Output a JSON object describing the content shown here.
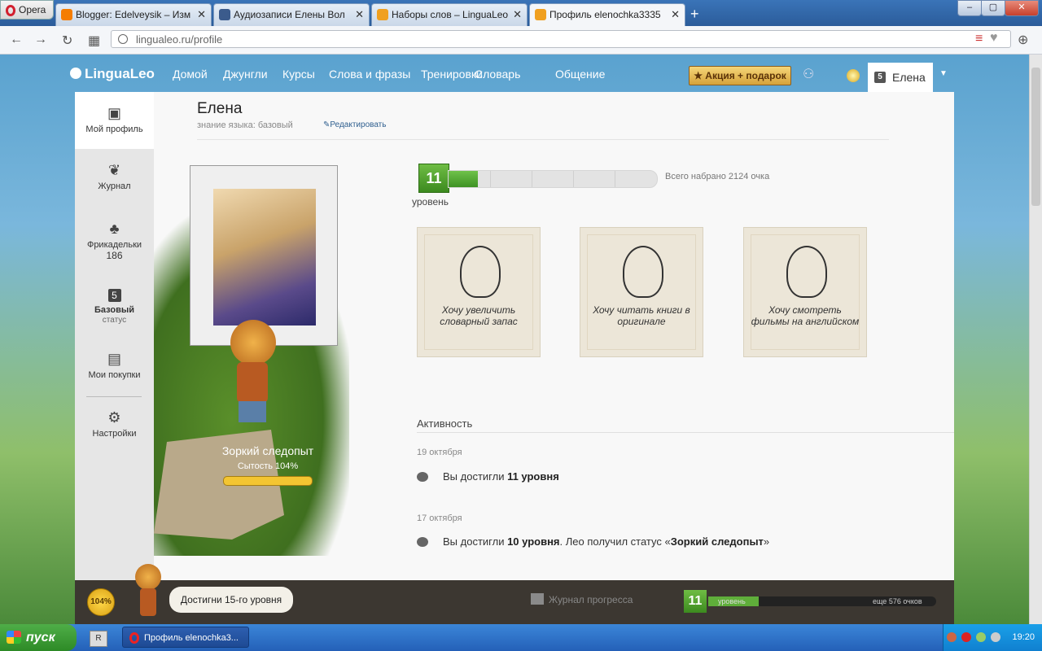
{
  "browser": {
    "opera_label": "Opera",
    "tabs": [
      {
        "title": "Blogger: Edelveysik – Изм",
        "active": false,
        "icon_color": "#f57d00"
      },
      {
        "title": "Аудиозаписи Елены Вол",
        "active": false,
        "icon_color": "#3b5b8c"
      },
      {
        "title": "Наборы слов – LinguaLeo",
        "active": false,
        "icon_color": "#f0a020"
      },
      {
        "title": "Профиль elenochka3335",
        "active": true,
        "icon_color": "#f0a020"
      }
    ],
    "newtab_glyph": "+",
    "url": "lingualeo.ru/profile"
  },
  "site": {
    "logo": "LinguaLeo",
    "menu": [
      "Домой",
      "Джунгли",
      "Курсы",
      "Слова и фразы",
      "Тренировки",
      "Словарь",
      "Общение"
    ],
    "promo": "★ Акция + подарок",
    "user_name": "Елена",
    "user_badge": "5"
  },
  "sidebar": {
    "items": [
      {
        "label": "Мой профиль",
        "icon": "profile-icon"
      },
      {
        "label": "Журнал",
        "icon": "leaf-icon"
      },
      {
        "label": "Фрикадельки",
        "count": "186",
        "icon": "meatballs-icon"
      },
      {
        "label": "Базовый",
        "sublabel": "статус",
        "icon": "status-badge-icon",
        "badge": "5"
      },
      {
        "label": "Мои покупки",
        "icon": "bag-icon"
      },
      {
        "label": "Настройки",
        "icon": "gear-icon"
      }
    ]
  },
  "profile": {
    "name": "Елена",
    "knowledge": "знание языка: базовый",
    "edit": "Редактировать",
    "leo_status": "Зоркий следопыт",
    "satiety": "Сытость 104%"
  },
  "level": {
    "value": "11",
    "label": "уровень",
    "progress_fraction": 0.14,
    "total": "Всего набрано 2124 очка"
  },
  "goals": [
    "Хочу увеличить словарный запас",
    "Хочу читать книги в оригинале",
    "Хочу смотреть фильмы на английском"
  ],
  "activity": {
    "title": "Активность",
    "entries": [
      {
        "date": "19 октября",
        "text_prefix": "Вы достигли ",
        "bold": "11 уровня",
        "text_suffix": "",
        "bold2": ""
      },
      {
        "date": "17 октября",
        "text_prefix": "Вы достигли ",
        "bold": "10 уровня",
        "text_suffix": ". Лео получил статус «",
        "bold2": "Зоркий следопыт",
        "text_end": "»"
      }
    ]
  },
  "bottombar": {
    "satiety_circle": "104%",
    "bubble": "Достигни 15-го уровня",
    "journal": "Журнал прогресса",
    "level": "11",
    "level_word": "уровень",
    "remaining": "еще 576 очков",
    "progress_fraction": 0.22
  },
  "taskbar": {
    "start": "пуск",
    "quicklaunch": "R",
    "item": "Профиль elenochka3...",
    "clock": "19:20"
  }
}
